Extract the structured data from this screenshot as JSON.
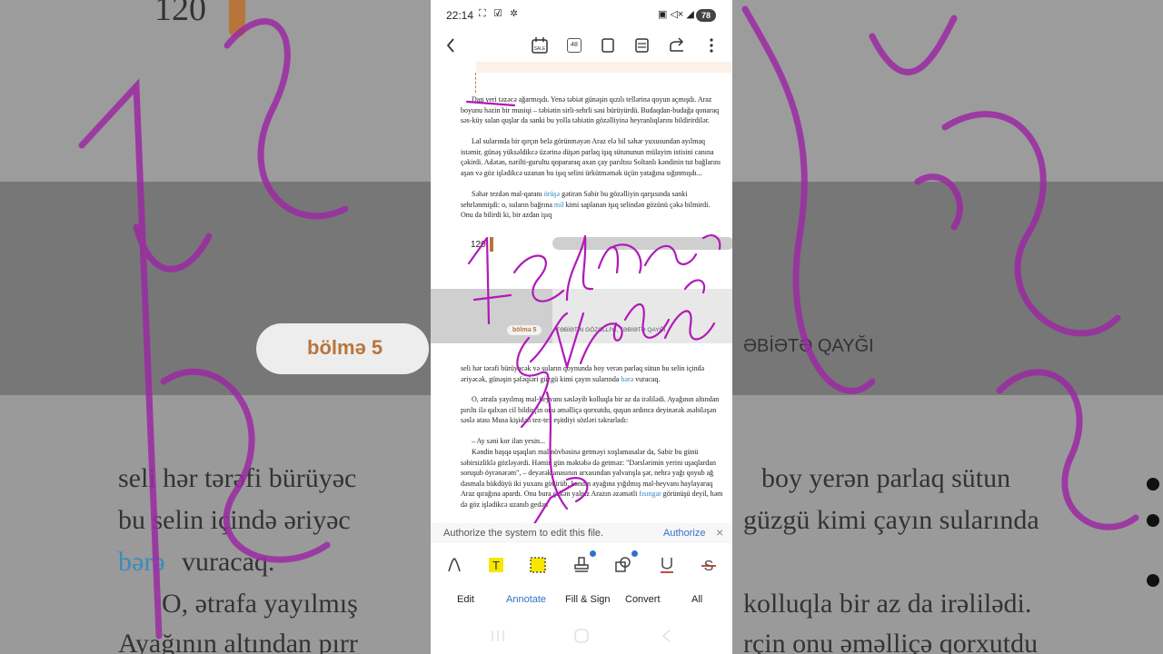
{
  "background": {
    "page_number": "120",
    "section_pill": "bölmə 5",
    "section_title_fragment": "ƏBİƏTƏ QAYĞI",
    "lines_left": [
      "seli hər tərəfi bürüyəc",
      "bu selin içində əriyəc",
      "bərə",
      "vuracaq.",
      "O, ətrafa yayılmış",
      "Ayağının altından pırr"
    ],
    "lines_right": [
      "boy  yerən parlaq sütun",
      "güzgü kimi çayın sularında",
      "kolluqla bir az da irəlilədi.",
      "rçin onu əməlliçə qorxutdu"
    ]
  },
  "status_bar": {
    "time": "22:14",
    "left_icons": "⛶ ☑ ✲",
    "right_icons": "▣ ◁× ◢",
    "battery": "78"
  },
  "toolbar": {
    "back_icon": "chevron-left-icon",
    "calendar_label": "SALE",
    "page_count": "48",
    "page_icon": "single-page-icon",
    "layout_icon": "layout-icon",
    "share_icon": "share-icon",
    "more_icon": "more-vertical-icon"
  },
  "document": {
    "page_number": "120",
    "section_pill": "bölmə 5",
    "section_title": "TƏBİƏTİN GÖZƏLLİYİ, TƏBİƏTƏ QAYĞI",
    "paragraph1": "Dan yeri təzəcə ağarmışdı. Yenə təbiət günəşin qızılı tellərinə qoyun açmışdı. Araz boyunu həzin bir musiqi – təbiətin sirli-sehrli səsi bürüyürdü. Budaqdan-budağa qonaraq səs-küy salan quşlar da sanki bu yolla təbiətin gözəlliyinə heyranlıqlarını bildirirdilər.",
    "paragraph2": "Lal sularında bir qırçın belə görünməyən Araz elə bil səhər yuxusundan ayılmaq istəmir, günəş yüksəldikcə üzərinə düşən parlaq işıq sütununun mülayim istisini canına çəkirdi. Adətən, nərilti-gurultu qopararaq axan çay parıltısı Soltanlı kəndinin tut bağlarını aşan və göz işlədikcə uzanan bu işıq selini ürkütməmək üçün yatağına sığınmışdı...",
    "paragraph3a": "Səhər tezdən mal-qaranı",
    "paragraph3_link1": "örüşə",
    "paragraph3b": "gətirən Sabir bu gözəlliyin qarşısında sanki sehrlənmişdi: o, suların bağrına",
    "paragraph3_link2": "mil",
    "paragraph3c": "kimi saplanan işıq selindən gözünü çəkə bilmirdi. Onu da bilirdi ki, bir azdan işıq",
    "paragraph4a": "seli hər tərəfi bürüyəcək və suların qoynunda boy verən parlaq sütun bu selin içində əriyəcək, günəşin şəfəqləri güzgü kimi çayın sularında",
    "paragraph4_link": "bərə",
    "paragraph4b": "vuracaq.",
    "paragraph5": "O, ətrafa yayılmış mal-heyvanı səsləyib kolluqla bir az da irəlilədi. Ayağının altından pırıltı ilə qalxan cil bildirçin onu əməlliçə qorxutdu, quşun ardınca deyinərək əsəbiləşən səslə atası Musa kişidən tez-tez eşitdiyi sözləri təkrarladı:",
    "paragraph6": "– Ay səni kor ilan yesin...",
    "paragraph7a": "Kəndin başqa uşaqları mal növbəsinə getməyi xoşlamasalar da, Sabir bu günü səbirsizliklə gözləyərdi. Həmin gün məktəbə də getməz: \"Dərslərimin yerini uşaqlardan soruşub öyrənərəm\", – deyərək anasının arxasından yalvarışla şər, nehrə yağı qoyub ağ dəsmala bükdüyü iki yuxanı götürüb, kəndin ayağına yığılmış mal-heyvanı haylayaraq Araz qırağına apardı. Onu bura çəkən yalnız Arazın əzəmətli",
    "paragraph7_link": "fısıngar",
    "paragraph7b": "görünüşü deyil, həm də göz işlədikcə uzanıb gedən"
  },
  "auth_bar": {
    "message": "Authorize the system to edit this file.",
    "button": "Authorize",
    "close": "×"
  },
  "annotation_tools": [
    "pen-icon",
    "highlight-text-icon",
    "area-highlight-icon",
    "stamp-icon",
    "shapes-icon",
    "underline-icon",
    "strikethrough-icon"
  ],
  "bottom_tabs": [
    {
      "label": "Edit"
    },
    {
      "label": "Annotate"
    },
    {
      "label": "Fill & Sign"
    },
    {
      "label": "Convert"
    },
    {
      "label": "All"
    }
  ],
  "colors": {
    "ink": "#b01ab8",
    "accent": "#2e73c8",
    "brand_orange": "#b8753b"
  }
}
